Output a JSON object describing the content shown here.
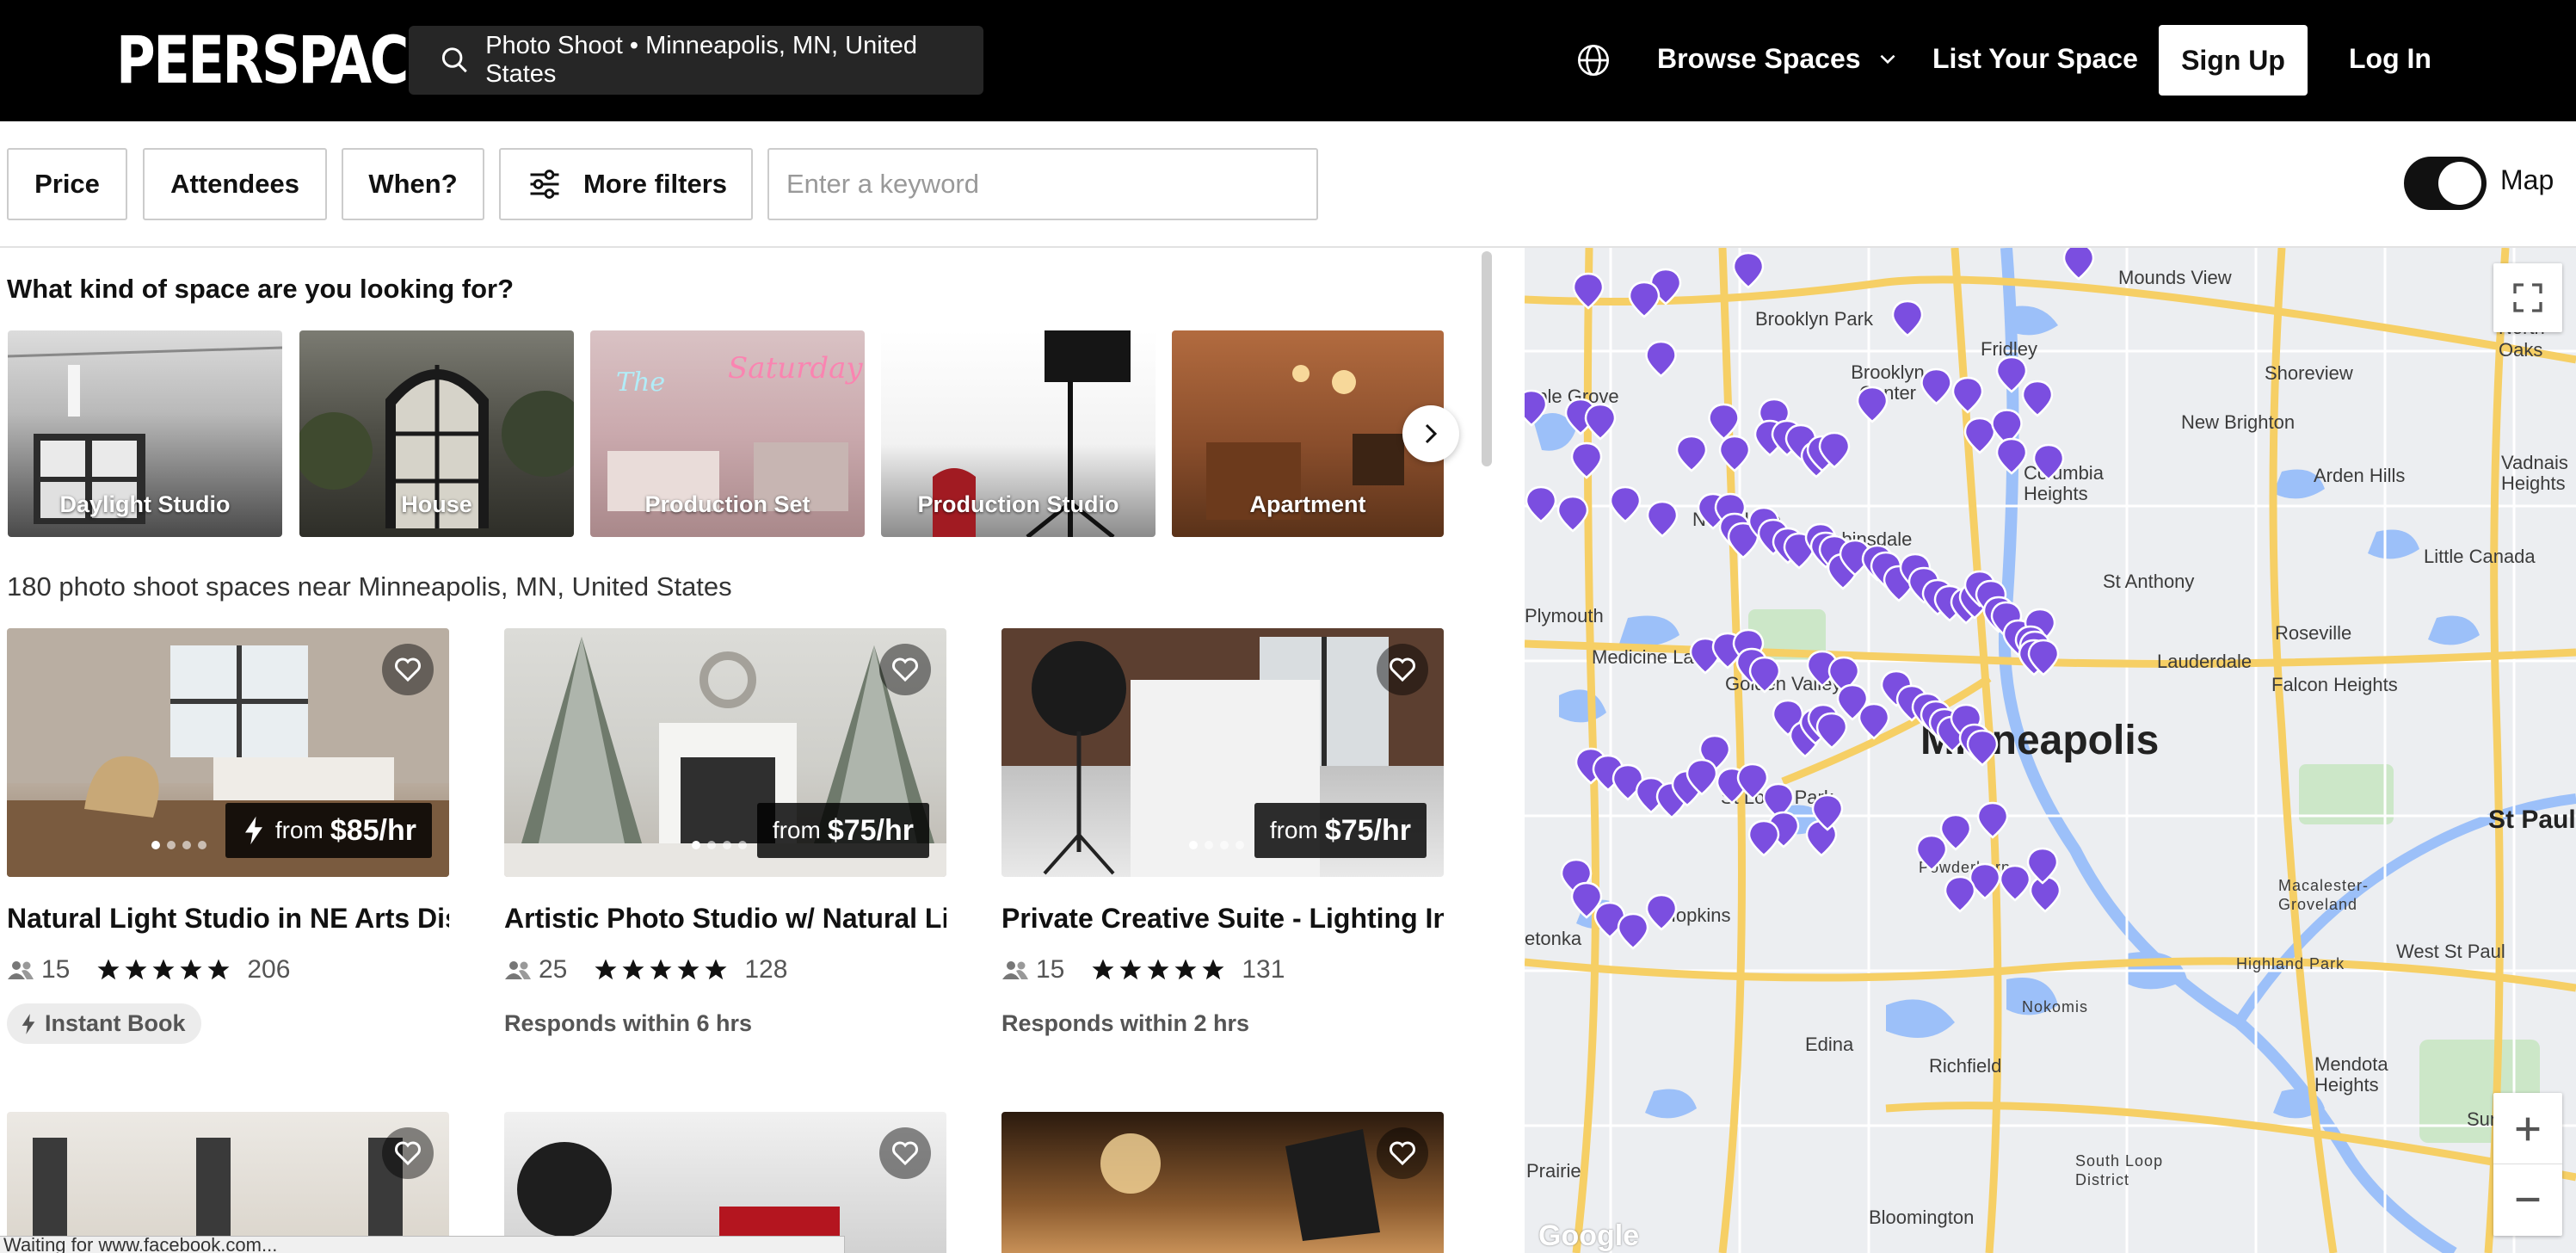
{
  "header": {
    "logo": "PEERSPACE",
    "search_text": "Photo Shoot • Minneapolis, MN, United States",
    "nav": {
      "browse": "Browse Spaces",
      "list": "List Your Space",
      "signup": "Sign Up",
      "login": "Log In"
    }
  },
  "filters": {
    "price": "Price",
    "attendees": "Attendees",
    "when": "When?",
    "more": "More filters",
    "keyword_placeholder": "Enter a keyword",
    "map_toggle_label": "Map",
    "map_toggle_on": true
  },
  "categories": {
    "title": "What kind of space are you looking for?",
    "items": [
      "Daylight Studio",
      "House",
      "Production Set",
      "Production Studio",
      "Apartment"
    ]
  },
  "results_text": "180 photo shoot spaces near Minneapolis, MN, United States",
  "listings": [
    {
      "title": "Natural Light Studio in NE Arts Dis...",
      "from": "from",
      "price": "$85/hr",
      "instant": true,
      "guests": "15",
      "rating_count": "206",
      "badge": "Instant Book"
    },
    {
      "title": "Artistic Photo Studio w/ Natural Li...",
      "from": "from",
      "price": "$75/hr",
      "instant": false,
      "guests": "25",
      "rating_count": "128",
      "responds": "Responds within 6 hrs"
    },
    {
      "title": "Private Creative Suite - Lighting In...",
      "from": "from",
      "price": "$75/hr",
      "instant": false,
      "guests": "15",
      "rating_count": "131",
      "responds": "Responds within 2 hrs"
    }
  ],
  "status_bar": "Waiting for www.facebook.com...",
  "map": {
    "city_label": "Minneapolis",
    "labels": [
      "Mounds View",
      "Brooklyn Park",
      "Brooklyn Center",
      "Fridley",
      "Shoreview",
      "North Oaks",
      "aple Grove",
      "New Brighton",
      "Columbia Heights",
      "Arden Hills",
      "Vadnais Heights",
      "New Hope",
      "Robbinsdale",
      "St Anthony",
      "Little Canada",
      "Plymouth",
      "Roseville",
      "Medicine Lake",
      "Golden Valley",
      "Lauderdale",
      "Falcon Heights",
      "St Louis Park",
      "St Paul",
      "Hopkins",
      "Powderhorn",
      "Macalester-Groveland",
      "etonka",
      "West St Paul",
      "Highland Park",
      "Nokomis",
      "Edina",
      "Richfield",
      "Mendota Heights",
      "Sunfish",
      "South Loop District",
      "Prairie",
      "Bloomington",
      "Google"
    ],
    "colors": {
      "pin": "#7b4ee0",
      "water": "#9cc0f9",
      "highway": "#f6cf65",
      "park": "#c9e6c3"
    }
  },
  "colors": {
    "header_bg": "#000000",
    "accent": "#7b4ee0"
  }
}
